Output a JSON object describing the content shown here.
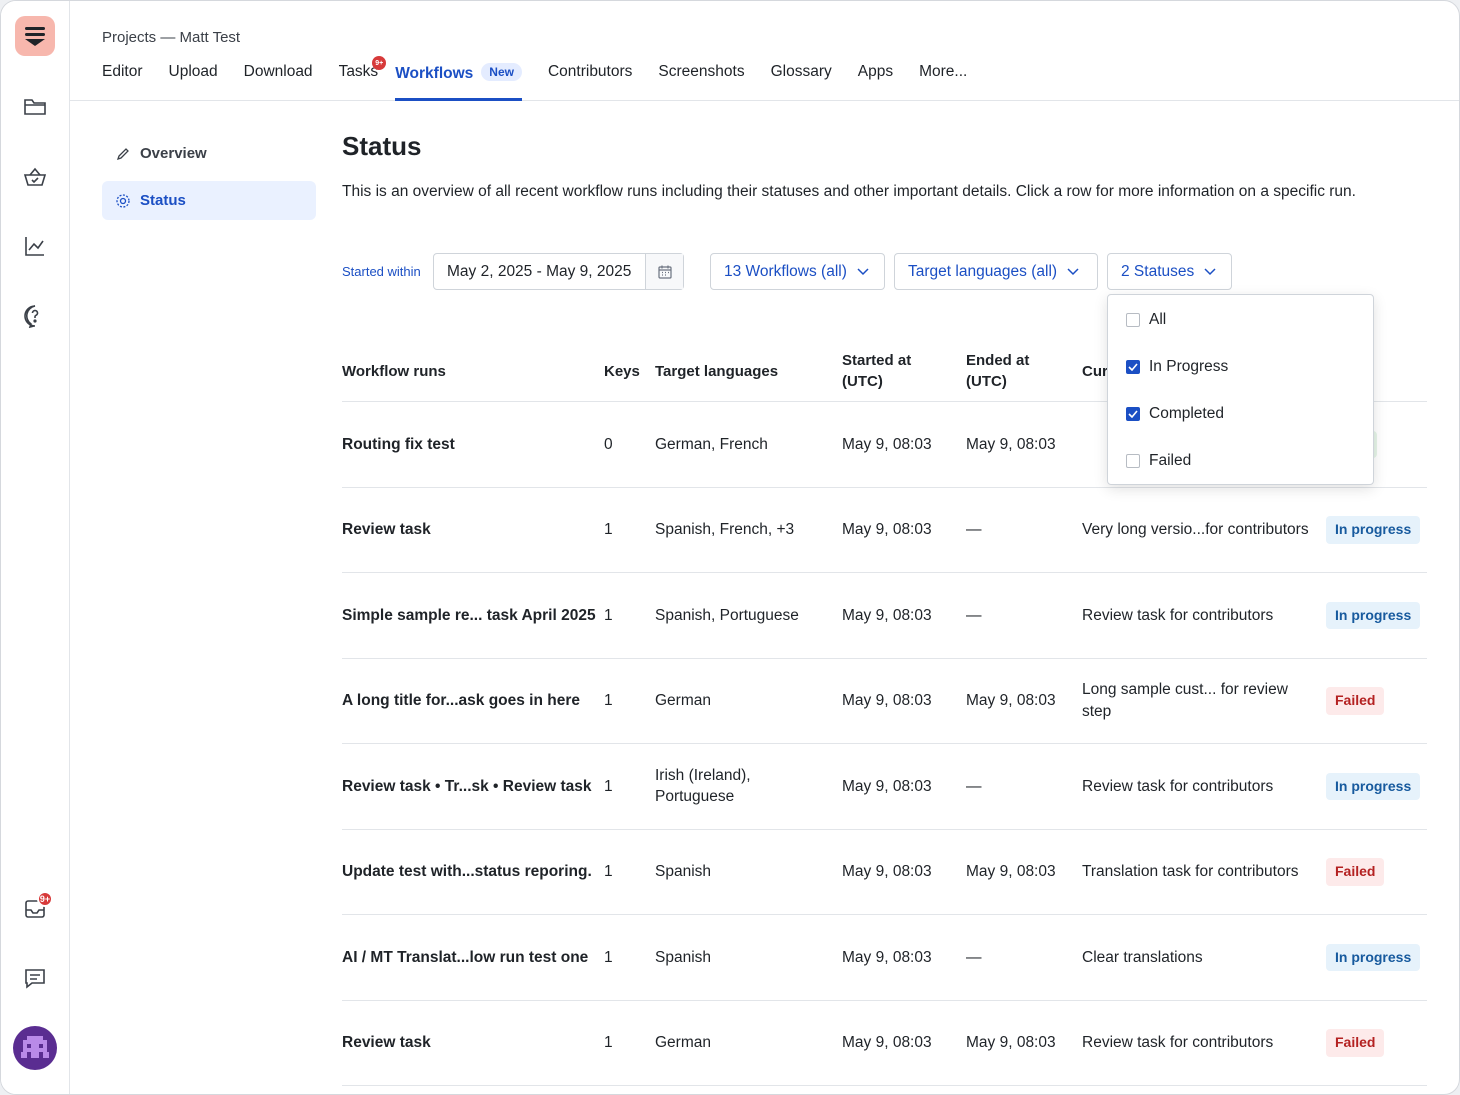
{
  "rail": {
    "icons": [
      "logo-icon",
      "folder-icon",
      "basket-check-icon",
      "chart-line-icon",
      "help-icon",
      "inbox-icon",
      "chat-icon"
    ],
    "inbox_badge": "9+"
  },
  "header": {
    "breadcrumb": "Projects — Matt Test",
    "tabs": [
      {
        "label": "Editor"
      },
      {
        "label": "Upload"
      },
      {
        "label": "Download"
      },
      {
        "label": "Tasks",
        "badge": "9+"
      },
      {
        "label": "Workflows",
        "pill": "New",
        "active": true
      },
      {
        "label": "Contributors"
      },
      {
        "label": "Screenshots"
      },
      {
        "label": "Glossary"
      },
      {
        "label": "Apps"
      },
      {
        "label": "More..."
      }
    ]
  },
  "sidenav": {
    "items": [
      {
        "label": "Overview",
        "icon": "pencil-icon"
      },
      {
        "label": "Status",
        "icon": "status-icon",
        "active": true
      }
    ]
  },
  "page": {
    "title": "Status",
    "description": "This is an overview of all recent workflow runs including their statuses and other important details. Click a row for more information on a specific run."
  },
  "filters": {
    "started_label": "Started within",
    "date_range": "May 2, 2025 - May 9, 2025",
    "workflows": "13 Workflows (all)",
    "languages": "Target languages (all)",
    "statuses": "2 Statuses"
  },
  "status_dropdown": {
    "options": [
      {
        "label": "All",
        "checked": false
      },
      {
        "label": "In Progress",
        "checked": true
      },
      {
        "label": "Completed",
        "checked": true
      },
      {
        "label": "Failed",
        "checked": false
      }
    ]
  },
  "table": {
    "headers": {
      "runs": "Workflow runs",
      "keys": "Keys",
      "languages": "Target languages",
      "started": "Started at (UTC)",
      "ended": "Ended at (UTC)",
      "current": "Cur"
    },
    "rows": [
      {
        "name": "Routing fix test",
        "keys": "0",
        "languages": "German, French",
        "started": "May 9, 08:03",
        "ended": "May 9, 08:03",
        "current": "",
        "status": "leted",
        "status_type": "completed"
      },
      {
        "name": "Review task",
        "keys": "1",
        "languages": "Spanish, French, +3",
        "started": "May 9, 08:03",
        "ended": "—",
        "current": "Very long versio...for contributors",
        "status": "In progress",
        "status_type": "progress"
      },
      {
        "name": "Simple sample re... task April 2025",
        "keys": "1",
        "languages": "Spanish, Portuguese",
        "started": "May 9, 08:03",
        "ended": "—",
        "current": "Review task for contributors",
        "status": "In progress",
        "status_type": "progress"
      },
      {
        "name": "A long title for...ask goes in here",
        "keys": "1",
        "languages": "German",
        "started": "May 9, 08:03",
        "ended": "May 9, 08:03",
        "current": "Long sample cust... for review step",
        "status": "Failed",
        "status_type": "failed"
      },
      {
        "name": "Review task • Tr...sk • Review task",
        "keys": "1",
        "languages": "Irish (Ireland), Portuguese",
        "started": "May 9, 08:03",
        "ended": "—",
        "current": "Review task for contributors",
        "status": "In progress",
        "status_type": "progress"
      },
      {
        "name": "Update test with...status reporing.",
        "keys": "1",
        "languages": "Spanish",
        "started": "May 9, 08:03",
        "ended": "May 9, 08:03",
        "current": "Translation task for contributors",
        "status": "Failed",
        "status_type": "failed"
      },
      {
        "name": "AI / MT Translat...low run test one",
        "keys": "1",
        "languages": "Spanish",
        "started": "May 9, 08:03",
        "ended": "—",
        "current": "Clear translations",
        "status": "In progress",
        "status_type": "progress"
      },
      {
        "name": "Review task",
        "keys": "1",
        "languages": "German",
        "started": "May 9, 08:03",
        "ended": "May 9, 08:03",
        "current": "Review task for contributors",
        "status": "Failed",
        "status_type": "failed"
      }
    ]
  },
  "colors": {
    "accent": "#1b4fc4",
    "logo_bg": "#f7b7ad",
    "badge": "#d73a3a",
    "avatar": "#5a2d91"
  }
}
